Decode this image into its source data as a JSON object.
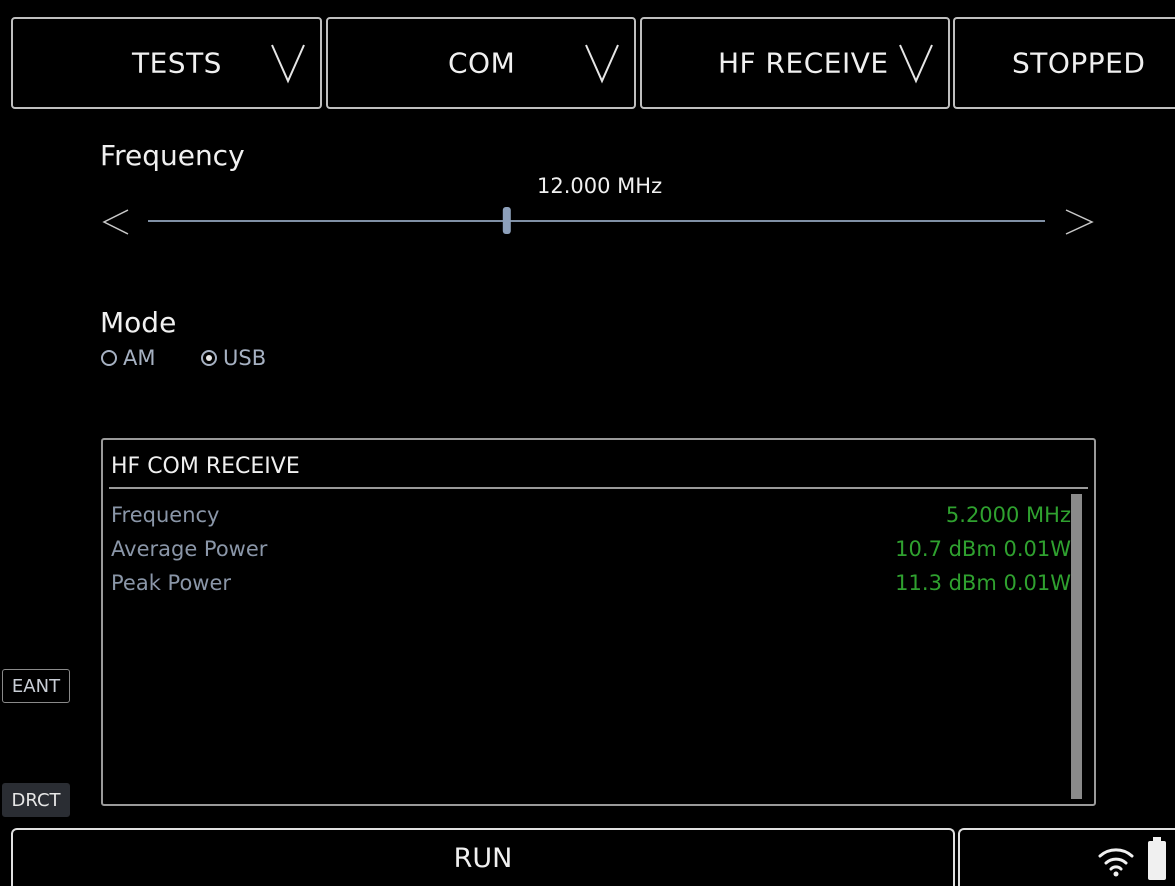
{
  "tabs": [
    {
      "label": "TESTS",
      "has_dropdown": true
    },
    {
      "label": "COM",
      "has_dropdown": true
    },
    {
      "label": "HF RECEIVE",
      "has_dropdown": true
    },
    {
      "label": "STOPPED",
      "has_dropdown": false
    }
  ],
  "frequency": {
    "label": "Frequency",
    "value_text": "12.000 MHz",
    "slider_fraction": 0.4
  },
  "mode": {
    "label": "Mode",
    "options": [
      {
        "label": "AM",
        "selected": false
      },
      {
        "label": "USB",
        "selected": true
      }
    ]
  },
  "panel": {
    "title": "HF COM RECEIVE",
    "rows": [
      {
        "label": "Frequency",
        "value": "5.2000 MHz"
      },
      {
        "label": "Average Power",
        "value": "10.7 dBm 0.01W"
      },
      {
        "label": "Peak Power",
        "value": "11.3 dBm 0.01W"
      }
    ]
  },
  "side_buttons": {
    "eant": "EANT",
    "drct": "DRCT"
  },
  "footer": {
    "run_label": "RUN"
  },
  "icons": {
    "wifi": "wifi-icon",
    "battery": "battery-icon",
    "dropdown": "chevron-down-icon"
  },
  "colors": {
    "value_green": "#2fa12f",
    "label_gray": "#8a96a8",
    "border": "#bfbfbf"
  }
}
